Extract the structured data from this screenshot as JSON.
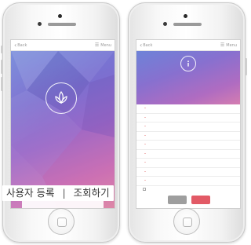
{
  "caption": {
    "register": "사용자 등록",
    "separator": "|",
    "lookup": "조회하기"
  },
  "left_phone": {
    "nav": {
      "back_label": "Back",
      "menu_label": "Menu"
    },
    "hero": {
      "tagline_small": "",
      "headline": "",
      "subline": ""
    },
    "icon": "lotus-icon"
  },
  "right_phone": {
    "nav": {
      "back_label": "Back",
      "menu_label": "Menu"
    },
    "icon": "info-icon",
    "notice_line1": "",
    "notice_line2": "",
    "form_rows": [
      {
        "label": "",
        "value": ""
      },
      {
        "label": "",
        "value": ""
      },
      {
        "label": "",
        "value": ""
      },
      {
        "label": "",
        "value": ""
      },
      {
        "label": "",
        "value": ""
      },
      {
        "label": "",
        "value": ""
      },
      {
        "label": "",
        "value": ""
      },
      {
        "label": "",
        "value": ""
      },
      {
        "label": "",
        "value": ""
      }
    ],
    "consent_text": "",
    "consent_link": "",
    "buttons": {
      "cancel": "",
      "submit": ""
    }
  },
  "colors": {
    "gradient_start": "#6d83d8",
    "gradient_end": "#d98aa9",
    "accent_red": "#e25a66"
  }
}
